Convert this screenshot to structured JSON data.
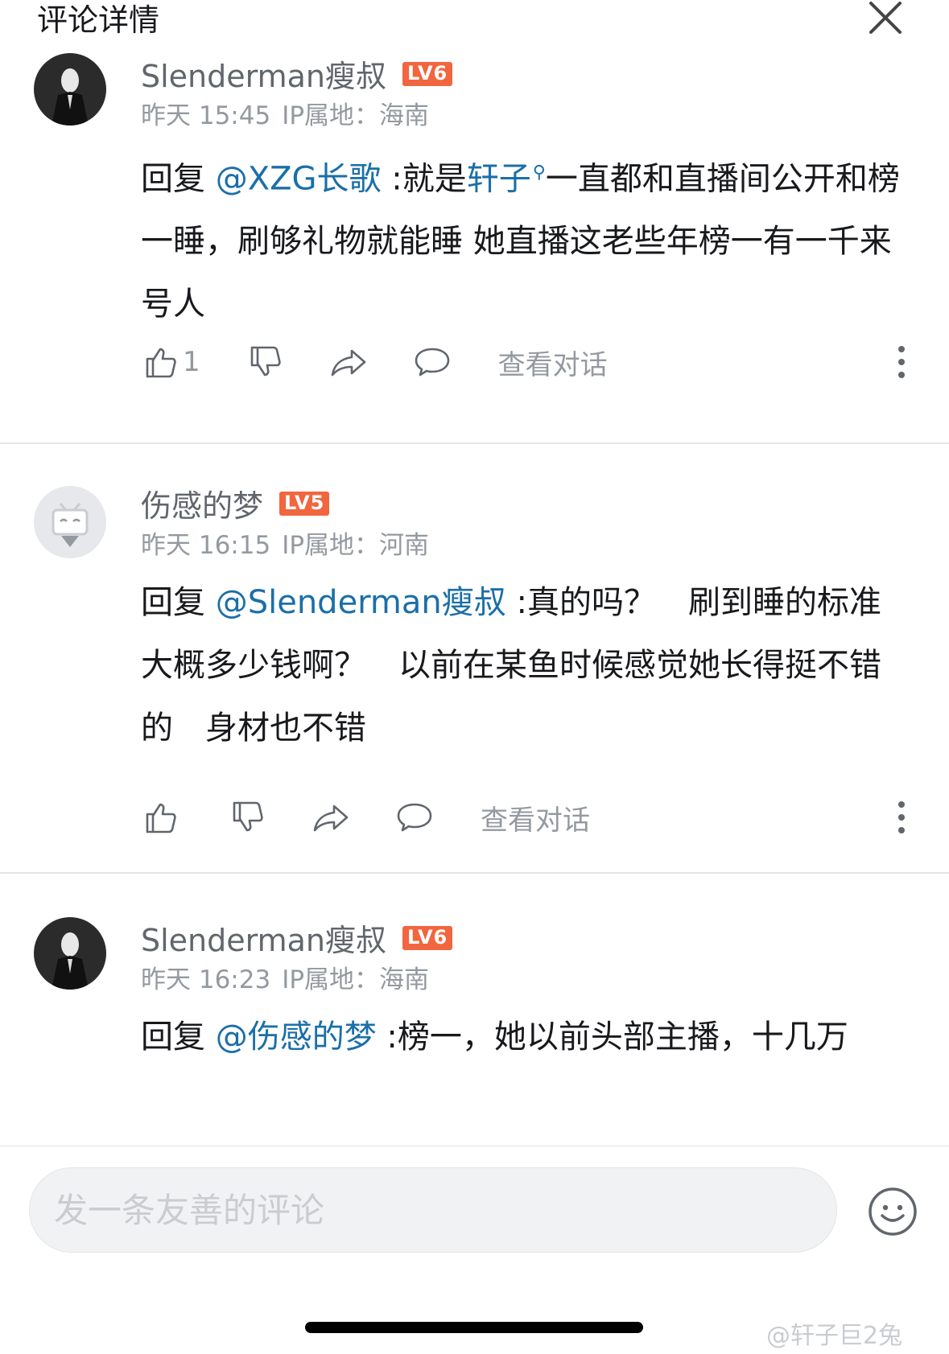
{
  "header": {
    "title": "评论详情"
  },
  "comments": [
    {
      "username": "Slenderman瘦叔",
      "level": "LV6",
      "time": "昨天 15:45",
      "ip": "IP属地：海南",
      "reply_prefix": "回复 ",
      "mention": "@XZG长歌",
      "text_before_kw": " :就是",
      "keyword": "轩子",
      "text_after_kw": "一直都和直播间公开和榜一睡，刷够礼物就能睡 她直播这老些年榜一有一千来号人",
      "like_count": "1",
      "view_conversation": "查看对话"
    },
    {
      "username": "伤感的梦",
      "level": "LV5",
      "time": "昨天 16:15",
      "ip": "IP属地：河南",
      "reply_prefix": "回复 ",
      "mention": "@Slenderman瘦叔",
      "text": " :真的吗？　刷到睡的标准大概多少钱啊？　以前在某鱼时候感觉她长得挺不错的　身材也不错",
      "like_count": "",
      "view_conversation": "查看对话"
    },
    {
      "username": "Slenderman瘦叔",
      "level": "LV6",
      "time": "昨天 16:23",
      "ip": "IP属地：海南",
      "reply_prefix": "回复 ",
      "mention": "@伤感的梦",
      "text": " :榜一，她以前头部主播，十几万"
    }
  ],
  "composer": {
    "placeholder": "发一条友善的评论"
  },
  "watermark": "@轩子巨2兔",
  "colors": {
    "mention": "#1b6fa8",
    "level_badge": "#f1663f",
    "meta": "#9499a0"
  }
}
